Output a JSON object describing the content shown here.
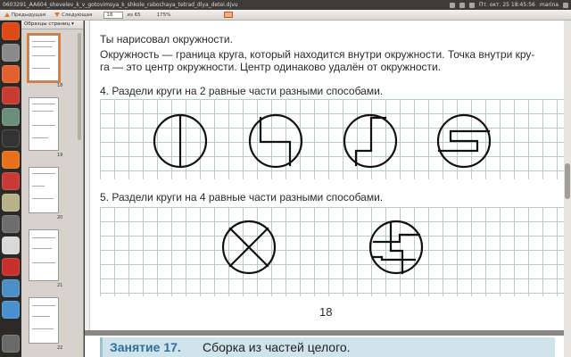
{
  "window": {
    "title": "0603291_AA604_shevelev_k_v_gotovimsya_k_shkole_rabochaya_tetrad_dlya_detei.djvu"
  },
  "panel": {
    "datetime": "Пт. окт. 25 18:45:56",
    "user": "marina"
  },
  "toolbar": {
    "prev_label": "Предыдущая",
    "next_label": "Следующая",
    "page_value": "18",
    "of_label": "из 65",
    "zoom": "175%"
  },
  "sidebar": {
    "header": "Образцы страниц ▾",
    "thumb_labels": [
      "18",
      "19",
      "20",
      "21",
      "22"
    ]
  },
  "page": {
    "intro": "Ты нарисовал окружности.",
    "definition_line1": "Окружность — граница круга, который находится внутри окружности. Точка внутри кру-",
    "definition_line2": "га — это центр окружности. Центр одинаково удалён от окружности.",
    "task4": "4. Раздели круги на 2 равные части разными способами.",
    "task5": "5. Раздели круги на 4 равные части разными способами.",
    "page_number": "18"
  },
  "next_page": {
    "lesson_number": "Занятие 17.",
    "lesson_title": "Сборка из частей целого."
  },
  "colors": {
    "accent": "#e07a2e",
    "lesson_blue": "#2f6f99",
    "lesson_bg": "#cfe3ea",
    "grid": "#b9c9cf"
  }
}
